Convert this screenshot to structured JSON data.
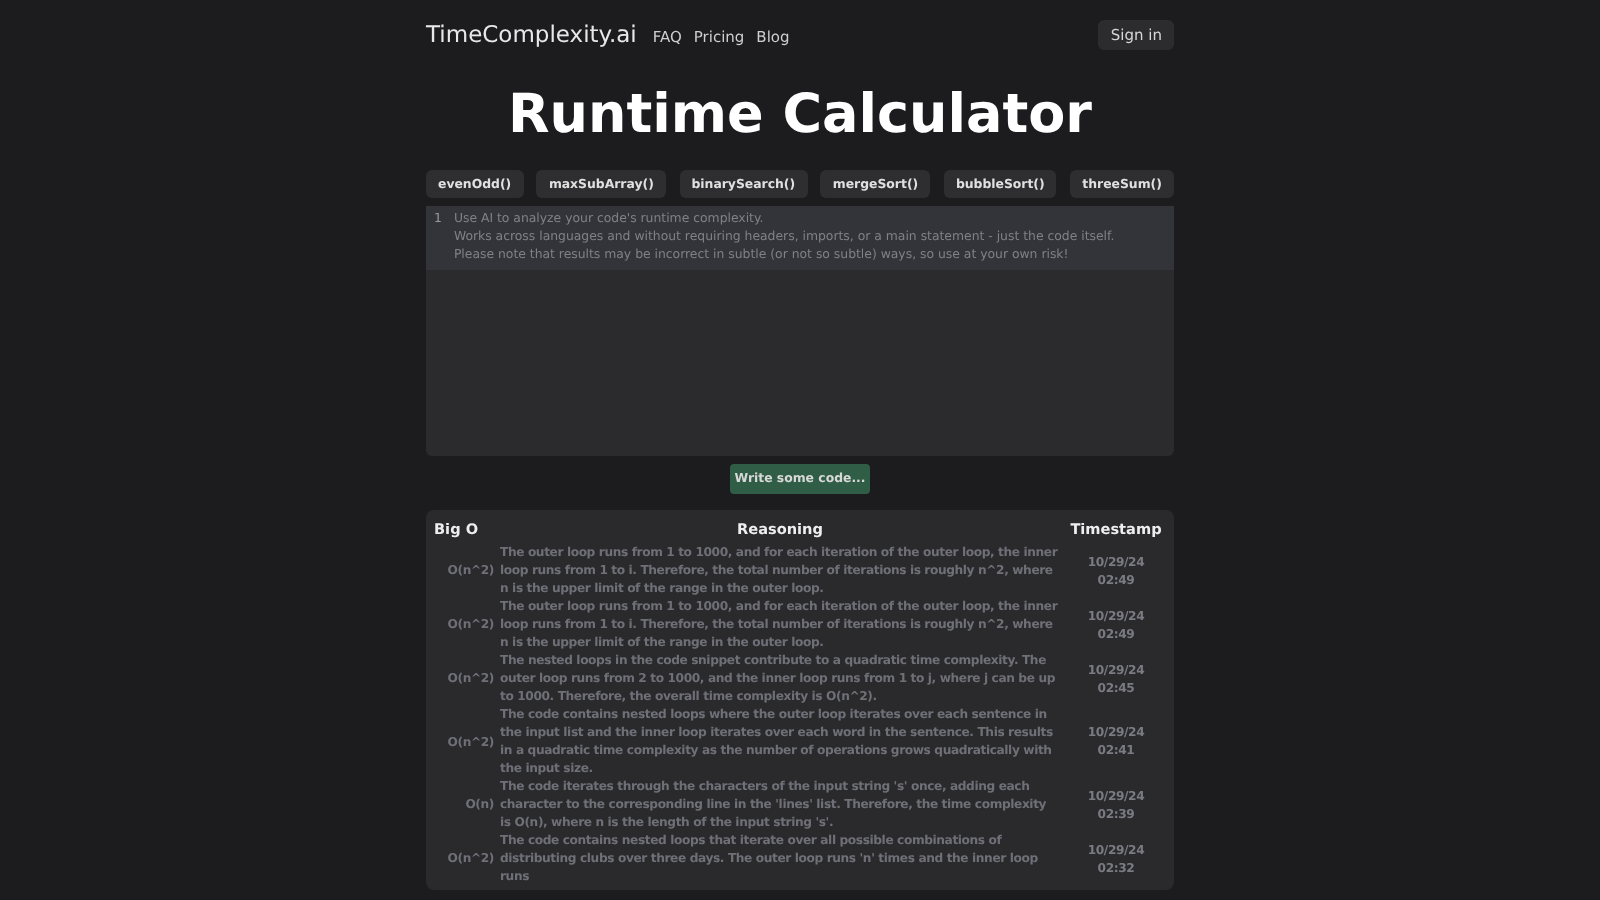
{
  "nav": {
    "brand": "TimeComplexity.ai",
    "links": [
      "FAQ",
      "Pricing",
      "Blog"
    ],
    "sign_in": "Sign in"
  },
  "title": "Runtime Calculator",
  "examples": [
    "evenOdd()",
    "maxSubArray()",
    "binarySearch()",
    "mergeSort()",
    "bubbleSort()",
    "threeSum()"
  ],
  "editor": {
    "line_number": "1",
    "placeholder": "Use AI to analyze your code's runtime complexity.\nWorks across languages and without requiring headers, imports, or a main statement - just the code itself.\nPlease note that results may be incorrect in subtle (or not so subtle) ways, so use at your own risk!"
  },
  "submit": {
    "label": "Write some code...",
    "disabled": true
  },
  "table": {
    "columns": [
      "Big O",
      "Reasoning",
      "Timestamp"
    ],
    "rows": [
      {
        "big_o": "O(n^2)",
        "reasoning": "The outer loop runs from 1 to 1000, and for each iteration of the outer loop, the inner loop runs from 1 to i. Therefore, the total number of iterations is roughly n^2, where n is the upper limit of the range in the outer loop.",
        "date": "10/29/24",
        "time": "02:49"
      },
      {
        "big_o": "O(n^2)",
        "reasoning": "The outer loop runs from 1 to 1000, and for each iteration of the outer loop, the inner loop runs from 1 to i. Therefore, the total number of iterations is roughly n^2, where n is the upper limit of the range in the outer loop.",
        "date": "10/29/24",
        "time": "02:49"
      },
      {
        "big_o": "O(n^2)",
        "reasoning": "The nested loops in the code snippet contribute to a quadratic time complexity. The outer loop runs from 2 to 1000, and the inner loop runs from 1 to j, where j can be up to 1000. Therefore, the overall time complexity is O(n^2).",
        "date": "10/29/24",
        "time": "02:45"
      },
      {
        "big_o": "O(n^2)",
        "reasoning": "The code contains nested loops where the outer loop iterates over each sentence in the input list and the inner loop iterates over each word in the sentence. This results in a quadratic time complexity as the number of operations grows quadratically with the input size.",
        "date": "10/29/24",
        "time": "02:41"
      },
      {
        "big_o": "O(n)",
        "reasoning": "The code iterates through the characters of the input string 's' once, adding each character to the corresponding line in the 'lines' list. Therefore, the time complexity is O(n), where n is the length of the input string 's'.",
        "date": "10/29/24",
        "time": "02:39"
      },
      {
        "big_o": "O(n^2)",
        "reasoning": "The code contains nested loops that iterate over all possible combinations of distributing clubs over three days. The outer loop runs 'n' times and the inner loop runs",
        "date": "10/29/24",
        "time": "02:32"
      }
    ]
  }
}
